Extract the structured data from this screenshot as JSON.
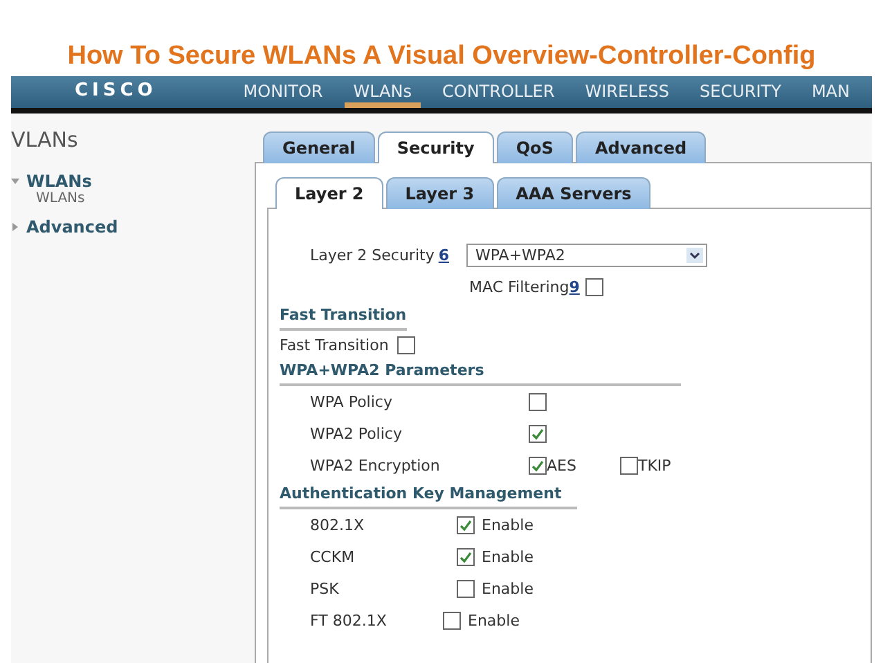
{
  "title": "How To Secure WLANs A Visual Overview-Controller-Config",
  "nav": {
    "logo": "CISCO",
    "items": [
      {
        "label": "MONITOR",
        "selected": false
      },
      {
        "label": "WLANs",
        "selected": true
      },
      {
        "label": "CONTROLLER",
        "selected": false
      },
      {
        "label": "WIRELESS",
        "selected": false
      },
      {
        "label": "SECURITY",
        "selected": false
      },
      {
        "label": "MAN",
        "selected": false
      }
    ]
  },
  "sidebar": {
    "heading": "VLANs",
    "items": [
      {
        "label": "WLANs",
        "children": [
          {
            "label": "WLANs"
          }
        ]
      },
      {
        "label": "Advanced"
      }
    ]
  },
  "tabs": [
    {
      "label": "General",
      "selected": false
    },
    {
      "label": "Security",
      "selected": true
    },
    {
      "label": "QoS",
      "selected": false
    },
    {
      "label": "Advanced",
      "selected": false
    }
  ],
  "subtabs": [
    {
      "label": "Layer 2",
      "selected": true
    },
    {
      "label": "Layer 3",
      "selected": false
    },
    {
      "label": "AAA Servers",
      "selected": false
    }
  ],
  "layer2_security": {
    "label": "Layer 2 Security",
    "footnote": "6",
    "value": "WPA+WPA2"
  },
  "mac_filtering": {
    "label": "MAC Filtering",
    "footnote": "9",
    "checked": false
  },
  "sections": [
    {
      "heading": "Fast Transition",
      "rows": [
        {
          "kind": "inline",
          "label": "Fast Transition",
          "checked": false
        }
      ]
    },
    {
      "heading": "WPA+WPA2 Parameters",
      "rows": [
        {
          "kind": "check",
          "label": "WPA Policy",
          "checked": false
        },
        {
          "kind": "check",
          "label": "WPA2 Policy",
          "checked": true
        },
        {
          "kind": "options",
          "label": "WPA2 Encryption",
          "options": [
            {
              "label": "AES",
              "checked": true
            },
            {
              "label": "TKIP",
              "checked": false
            }
          ]
        }
      ]
    },
    {
      "heading": "Authentication Key Management",
      "rows": [
        {
          "kind": "enable",
          "label": "802.1X",
          "checked": true,
          "option": "Enable"
        },
        {
          "kind": "enable",
          "label": "CCKM",
          "checked": true,
          "option": "Enable"
        },
        {
          "kind": "enable",
          "label": "PSK",
          "checked": false,
          "option": "Enable"
        },
        {
          "kind": "enable",
          "label": "FT 802.1X",
          "checked": false,
          "option": "Enable"
        }
      ]
    }
  ]
}
